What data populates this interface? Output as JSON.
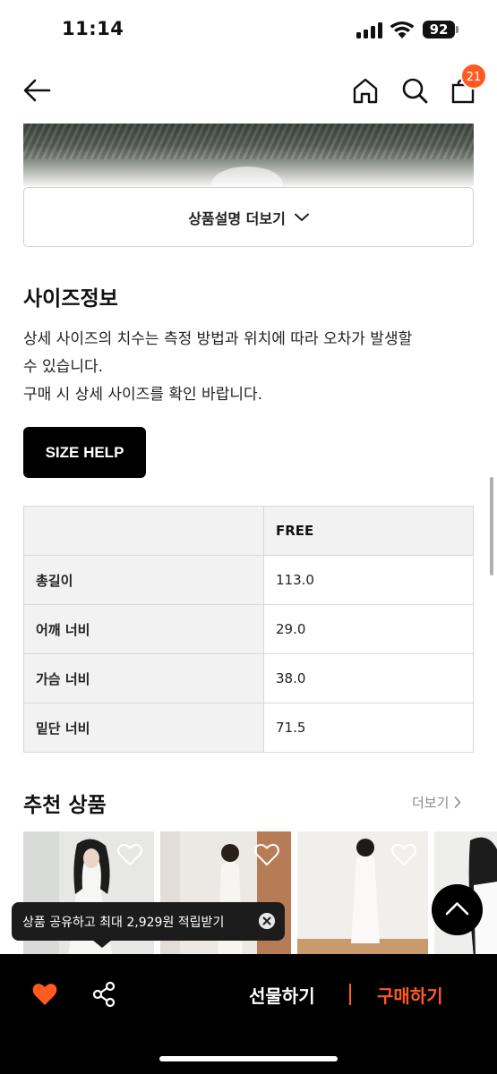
{
  "status_bar": {
    "time": "11:14",
    "battery": "92"
  },
  "nav": {
    "cart_count": "21"
  },
  "product": {
    "more_description_label": "상품설명 더보기"
  },
  "size_info": {
    "title": "사이즈정보",
    "description_line1": "상세 사이즈의 치수는 측정 방법과 위치에 따라 오차가 발생할",
    "description_line2": "수 있습니다.",
    "description_line3": "구매 시 상세 사이즈를 확인 바랍니다.",
    "size_help_label": "SIZE HELP",
    "table": {
      "column_header": "FREE",
      "rows": [
        {
          "label": "총길이",
          "value": "113.0"
        },
        {
          "label": "어깨 너비",
          "value": "29.0"
        },
        {
          "label": "가슴 너비",
          "value": "38.0"
        },
        {
          "label": "밑단 너비",
          "value": "71.5"
        }
      ]
    }
  },
  "recommended": {
    "title": "추천 상품",
    "more_label": "더보기"
  },
  "tooltip": {
    "text": "상품 공유하고 최대 2,929원 적립받기"
  },
  "bottom_bar": {
    "gift_label": "선물하기",
    "buy_label": "구매하기"
  },
  "colors": {
    "accent": "#ff5a1f",
    "dark": "#000000"
  }
}
